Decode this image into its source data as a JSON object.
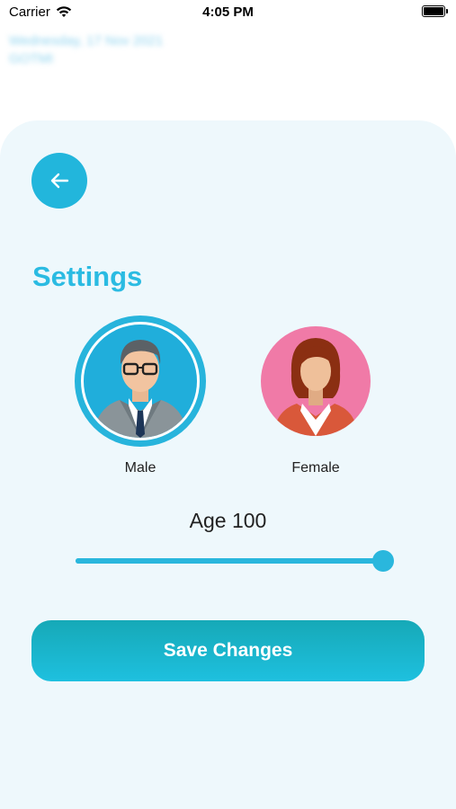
{
  "status_bar": {
    "carrier": "Carrier",
    "time": "4:05 PM"
  },
  "header": {
    "date_line": "Wednesday, 17 Nov 2021",
    "sub_line": "GOTMI"
  },
  "settings": {
    "title": "Settings",
    "back_icon": "arrow-left-icon"
  },
  "gender": {
    "selected": "Male",
    "options": [
      {
        "label": "Male",
        "icon": "male-avatar-icon",
        "color": "#20aedb"
      },
      {
        "label": "Female",
        "icon": "female-avatar-icon",
        "color": "#f07aa7"
      }
    ]
  },
  "age": {
    "label": "Age 100",
    "value": 100,
    "fraction": 1.0
  },
  "actions": {
    "save_label": "Save Changes"
  },
  "colors": {
    "accent": "#2bbbe2",
    "panel_bg": "#eef8fc",
    "button_gradient_start": "#16a9b7",
    "button_gradient_end": "#1ec0df"
  }
}
